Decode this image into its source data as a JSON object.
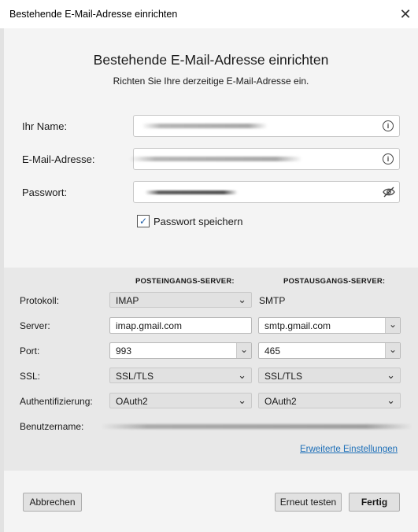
{
  "window": {
    "title": "Bestehende E-Mail-Adresse einrichten",
    "close_glyph": "✕"
  },
  "header": {
    "title": "Bestehende E-Mail-Adresse einrichten",
    "subtitle": "Richten Sie Ihre derzeitige E-Mail-Adresse ein."
  },
  "form": {
    "name_label": "Ihr Name:",
    "email_label": "E-Mail-Adresse:",
    "password_label": "Passwort:",
    "save_password_label": "Passwort speichern",
    "save_password_checked": true
  },
  "server": {
    "incoming_header": "POSTEINGANGS-SERVER:",
    "outgoing_header": "POSTAUSGANGS-SERVER:",
    "protocol_label": "Protokoll:",
    "server_label": "Server:",
    "port_label": "Port:",
    "ssl_label": "SSL:",
    "auth_label": "Authentifizierung:",
    "username_label": "Benutzername:",
    "incoming": {
      "protocol": "IMAP",
      "server": "imap.gmail.com",
      "port": "993",
      "ssl": "SSL/TLS",
      "auth": "OAuth2"
    },
    "outgoing": {
      "protocol": "SMTP",
      "server": "smtp.gmail.com",
      "port": "465",
      "ssl": "SSL/TLS",
      "auth": "OAuth2"
    },
    "advanced_link": "Erweiterte Einstellungen"
  },
  "buttons": {
    "cancel": "Abbrechen",
    "retest": "Erneut testen",
    "done": "Fertig"
  }
}
